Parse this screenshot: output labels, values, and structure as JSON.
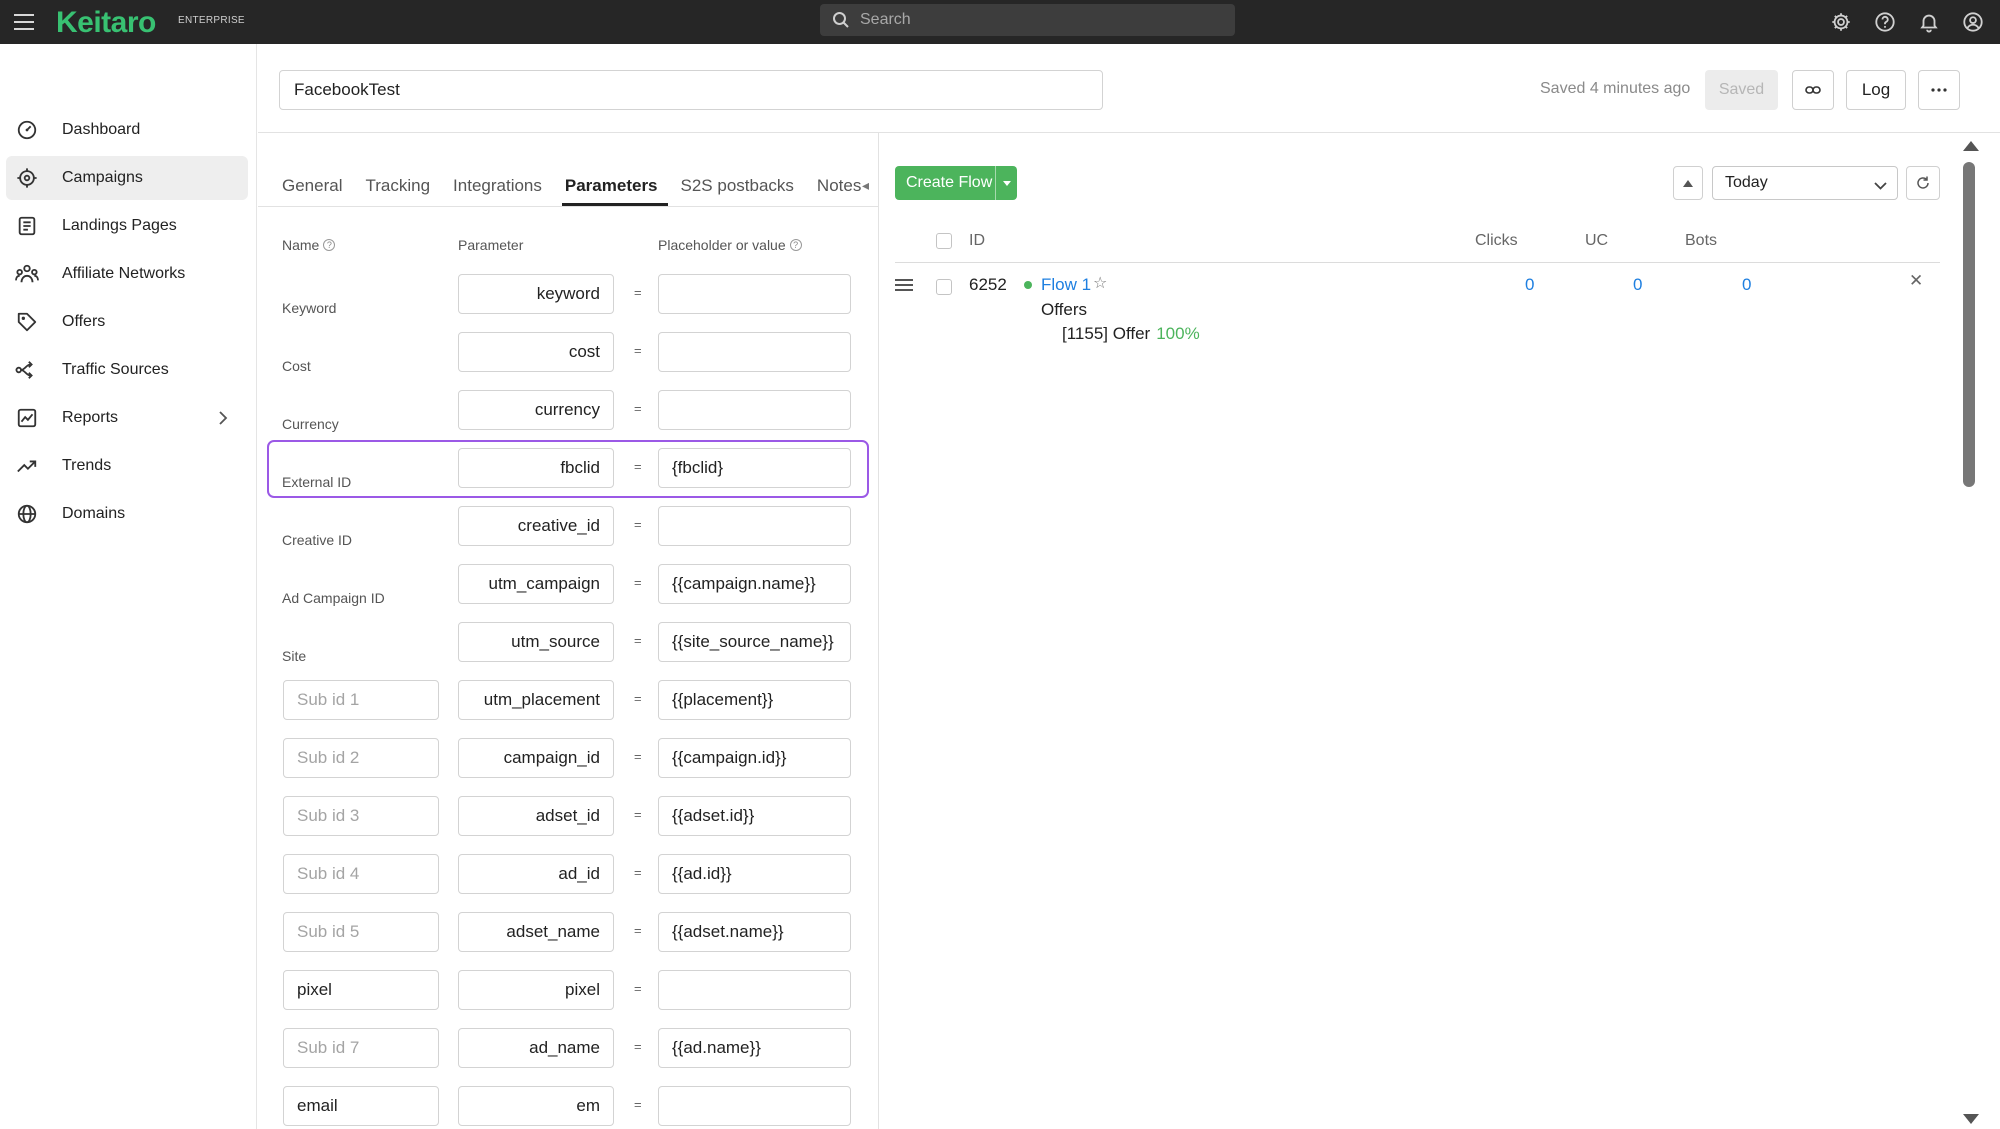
{
  "app": {
    "logo": "Keitaro",
    "edition": "ENTERPRISE",
    "search_placeholder": "Search",
    "top_icons": [
      "gear-icon",
      "help-icon",
      "bell-icon",
      "user-icon"
    ]
  },
  "sidebar": {
    "items": [
      {
        "label": "Dashboard",
        "icon": "dashboard-icon"
      },
      {
        "label": "Campaigns",
        "icon": "target-icon",
        "active": true
      },
      {
        "label": "Landings Pages",
        "icon": "document-icon"
      },
      {
        "label": "Affiliate Networks",
        "icon": "network-icon"
      },
      {
        "label": "Offers",
        "icon": "tag-icon"
      },
      {
        "label": "Traffic Sources",
        "icon": "source-icon"
      },
      {
        "label": "Reports",
        "icon": "report-icon",
        "has_children": true
      },
      {
        "label": "Trends",
        "icon": "trend-icon"
      },
      {
        "label": "Domains",
        "icon": "globe-icon"
      }
    ]
  },
  "campaign": {
    "name": "FacebookTest",
    "saved_status": "Saved 4 minutes ago",
    "saved_button": "Saved",
    "log_button": "Log"
  },
  "tabs": [
    "General",
    "Tracking",
    "Integrations",
    "Parameters",
    "S2S postbacks",
    "Notes"
  ],
  "active_tab": "Parameters",
  "params": {
    "headers": {
      "name": "Name",
      "parameter": "Parameter",
      "value": "Placeholder or value"
    },
    "equals": "=",
    "rows": [
      {
        "label": "Keyword",
        "parameter": "keyword",
        "value": ""
      },
      {
        "label": "Cost",
        "parameter": "cost",
        "value": ""
      },
      {
        "label": "Currency",
        "parameter": "currency",
        "value": ""
      },
      {
        "label": "External ID",
        "parameter": "fbclid",
        "value": "{fbclid}",
        "highlighted": true
      },
      {
        "label": "Creative ID",
        "parameter": "creative_id",
        "value": ""
      },
      {
        "label": "Ad Campaign ID",
        "parameter": "utm_campaign",
        "value": "{{campaign.name}}"
      },
      {
        "label": "Site",
        "parameter": "utm_source",
        "value": "{{site_source_name}}"
      },
      {
        "name_value": "",
        "name_placeholder": "Sub id 1",
        "parameter": "utm_placement",
        "value": "{{placement}}"
      },
      {
        "name_value": "",
        "name_placeholder": "Sub id 2",
        "parameter": "campaign_id",
        "value": "{{campaign.id}}"
      },
      {
        "name_value": "",
        "name_placeholder": "Sub id 3",
        "parameter": "adset_id",
        "value": "{{adset.id}}"
      },
      {
        "name_value": "",
        "name_placeholder": "Sub id 4",
        "parameter": "ad_id",
        "value": "{{ad.id}}"
      },
      {
        "name_value": "",
        "name_placeholder": "Sub id 5",
        "parameter": "adset_name",
        "value": "{{adset.name}}"
      },
      {
        "name_value": "pixel",
        "name_placeholder": "",
        "parameter": "pixel",
        "value": ""
      },
      {
        "name_value": "",
        "name_placeholder": "Sub id 7",
        "parameter": "ad_name",
        "value": "{{ad.name}}"
      },
      {
        "name_value": "email",
        "name_placeholder": "",
        "parameter": "em",
        "value": ""
      }
    ]
  },
  "flows": {
    "create_button": "Create Flow",
    "date_range": "Today",
    "columns": {
      "id": "ID",
      "clicks": "Clicks",
      "uc": "UC",
      "bots": "Bots"
    },
    "rows": [
      {
        "id": "6252",
        "name": "Flow 1",
        "status_color": "#4cb45c",
        "offers_label": "Offers",
        "offer": "[1155] Offer",
        "offer_share": "100%",
        "clicks": "0",
        "uc": "0",
        "bots": "0"
      }
    ]
  },
  "colors": {
    "brand_green": "#38c172",
    "button_green": "#4cb45c",
    "link_blue": "#1e7fe0",
    "highlight_purple": "#9b59e6",
    "topbar": "#262626"
  }
}
